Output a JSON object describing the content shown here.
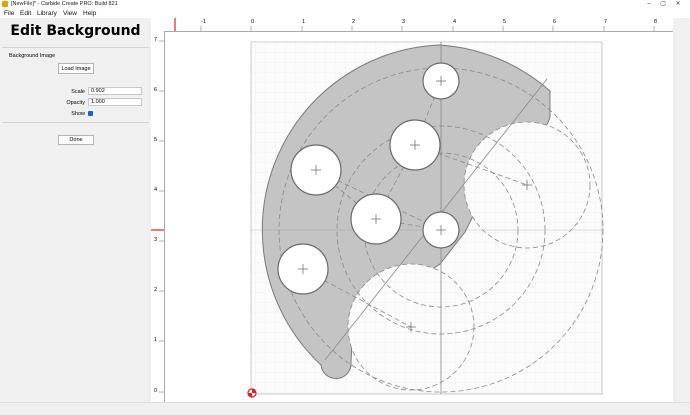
{
  "window": {
    "title": "[NewFile]* - Carbide Create PRO: Build 821",
    "minimize": "–",
    "maximize": "▢",
    "close": "✕"
  },
  "menu": [
    {
      "label": "File"
    },
    {
      "label": "Edit"
    },
    {
      "label": "Library"
    },
    {
      "label": "View"
    },
    {
      "label": "Help"
    }
  ],
  "panel": {
    "title": "Edit Background",
    "section_label": "Background Image",
    "load_button": "Load Image",
    "scale_label": "Scale",
    "scale_value": "0.902",
    "opacity_label": "Opacity",
    "opacity_value": "1.000",
    "show_label": "Show",
    "show_checked": true,
    "done_button": "Done"
  },
  "rulers": {
    "top_ticks": [
      "-1",
      "0",
      "1",
      "2",
      "3",
      "4",
      "5",
      "6",
      "7",
      "8"
    ],
    "left_ticks": [
      "7",
      "6",
      "5",
      "4",
      "3",
      "2",
      "1",
      "0"
    ],
    "marker_color": "#e02020"
  },
  "colors": {
    "accent": "#1f5fbf",
    "part_fill": "#c4c4c4",
    "grid": "#d9d9d9",
    "origin": "#e02020"
  }
}
